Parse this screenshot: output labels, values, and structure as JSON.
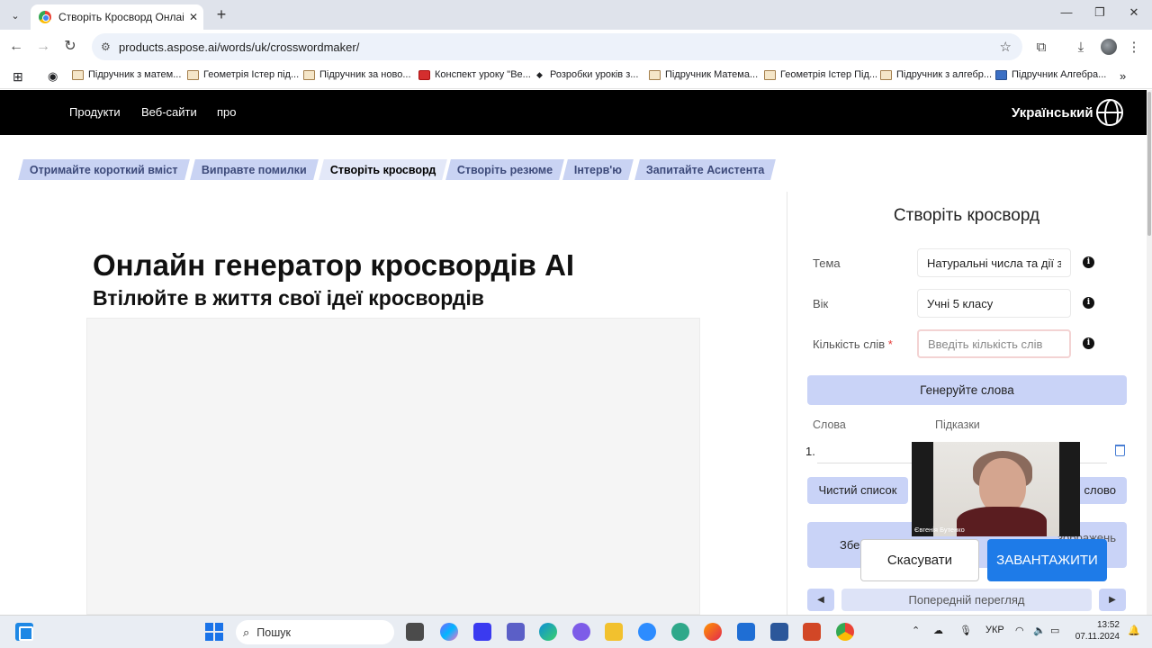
{
  "browser": {
    "tab_title": "Створіть Кросворд Онлайн За",
    "url": "products.aspose.ai/words/uk/crosswordmaker/",
    "bookmarks": [
      "Підручник з матем...",
      "Геометрія Істер під...",
      "Підручник за ново...",
      "Конспект уроку \"Ве...",
      "Розробки уроків з...",
      "Підручник Матема...",
      "Геометрія Істер Під...",
      "Підручник з алгебр...",
      "Підручник Алгебра..."
    ]
  },
  "site_header": {
    "nav": [
      "Продукти",
      "Веб-сайти",
      "про"
    ],
    "language": "Український"
  },
  "feature_tabs": [
    "Отримайте короткий вміст",
    "Виправте помилки",
    "Створіть кросворд",
    "Створіть резюме",
    "Інтерв'ю",
    "Запитайте Асистента"
  ],
  "main": {
    "title": "Онлайн генератор кросвордів AI",
    "subtitle": "Втілюйте в життя свої ідеї кросвордів"
  },
  "panel": {
    "title": "Створіть кросворд",
    "fields": [
      {
        "label": "Тема",
        "value": "Натуральні числа та дії з",
        "placeholder": ""
      },
      {
        "label": "Вік",
        "value": "Учні 5 класу",
        "placeholder": ""
      },
      {
        "label": "Кількість слів",
        "required_mark": "*",
        "value": "",
        "placeholder": "Введіть кількість слів"
      }
    ],
    "generate_button": "Генеруйте слова",
    "col_words": "Слова",
    "col_hints": "Підказки",
    "row_number": "1.",
    "clear_button": "Чистий список",
    "add_button_visible": "слово",
    "save_left_visible": "Збе",
    "save_right_visible": "зображень",
    "preview_label": "Попередній перегляд"
  },
  "video": {
    "participant": "Євгенія Бутенко"
  },
  "dialog": {
    "cancel": "Скасувати",
    "download": "ЗАВАНТАЖИТИ"
  },
  "taskbar": {
    "search": "Пошук",
    "language": "УКР",
    "time": "13:52",
    "date": "07.11.2024"
  }
}
